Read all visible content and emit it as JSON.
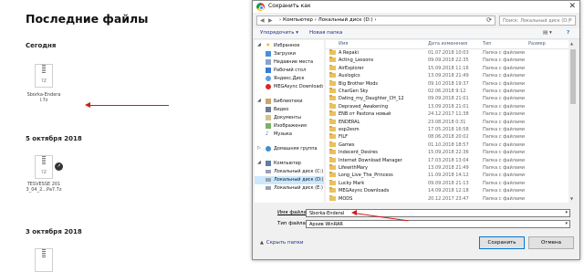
{
  "background": {
    "title": "Последние файлы",
    "sections": [
      {
        "label": "Сегодня",
        "file": {
          "ext": "7Z",
          "name_line1": "Sborka-Endera",
          "name_line2": "l.7z"
        }
      },
      {
        "label": "5 октября 2018",
        "file": {
          "ext": "7Z",
          "name_line1": "TESVESSE 201",
          "name_line2": "3_04_2...Pa7.7z"
        }
      },
      {
        "label": "3 октября 2018"
      }
    ]
  },
  "dialog": {
    "title": "Сохранить как",
    "close_icon": "close-icon",
    "address": {
      "crumbs": "›  Компьютер  ›  Локальный диск (D:)  ›"
    },
    "search_placeholder": "Поиск: Локальный диск (D:)",
    "toolbar": {
      "organize": "Упорядочить ▾",
      "new_folder": "Новая папка"
    },
    "nav": [
      {
        "label": "Избранное",
        "icon": "star-icon",
        "expander": "◢"
      },
      {
        "label": "Загрузки",
        "icon": "downloads-icon"
      },
      {
        "label": "Недавние места",
        "icon": "recent-places-icon"
      },
      {
        "label": "Рабочий стол",
        "icon": "desktop-icon"
      },
      {
        "label": "Яндекс.Диск",
        "icon": "yandex-disk-icon"
      },
      {
        "label": "MEGAsync Downloads",
        "icon": "mega-icon"
      },
      {
        "label": "Библиотеки",
        "icon": "libraries-icon",
        "expander": "◢"
      },
      {
        "label": "Видео",
        "icon": "video-icon"
      },
      {
        "label": "Документы",
        "icon": "documents-icon"
      },
      {
        "label": "Изображения",
        "icon": "images-icon"
      },
      {
        "label": "Музыка",
        "icon": "music-icon"
      },
      {
        "label": "Домашняя группа",
        "icon": "homegroup-icon",
        "expander": "▷"
      },
      {
        "label": "Компьютер",
        "icon": "computer-icon",
        "expander": "◢"
      },
      {
        "label": "Локальный диск (C:)",
        "icon": "drive-icon"
      },
      {
        "label": "Локальный диск (D:)",
        "icon": "drive-icon",
        "selected": true
      },
      {
        "label": "Локальный диск (E:)",
        "icon": "drive-icon"
      }
    ],
    "columns": {
      "name": "Имя",
      "date": "Дата изменения",
      "type": "Тип",
      "size": "Размер"
    },
    "rows": [
      {
        "name": "A Repaki",
        "date": "01.07.2018 10:03",
        "type": "Папка с файлами"
      },
      {
        "name": "Acting_Lessons",
        "date": "09.09.2018 22:35",
        "type": "Папка с файлами"
      },
      {
        "name": "AirExplorer",
        "date": "15.09.2018 11:16",
        "type": "Папка с файлами"
      },
      {
        "name": "Auslogics",
        "date": "13.09.2018 21:49",
        "type": "Папка с файлами"
      },
      {
        "name": "Big Brother Mods",
        "date": "09.10.2018 19:37",
        "type": "Папка с файлами"
      },
      {
        "name": "CharGen Sky",
        "date": "02.06.2018 9:12",
        "type": "Папка с файлами"
      },
      {
        "name": "Dating_my_Daughter_CH_12",
        "date": "09.09.2018 21:01",
        "type": "Папка с файлами"
      },
      {
        "name": "Depraved_Awakening",
        "date": "13.09.2018 21:01",
        "type": "Папка с файлами"
      },
      {
        "name": "ENB от Pastona новый",
        "date": "24.12.2017 11:38",
        "type": "Папка с файлами"
      },
      {
        "name": "ENDERAL",
        "date": "23.08.2018 0:31",
        "type": "Папка с файлами"
      },
      {
        "name": "esp2esm",
        "date": "17.05.2018 16:58",
        "type": "Папка с файлами"
      },
      {
        "name": "FILF",
        "date": "08.06.2018 20:02",
        "type": "Папка с файлами"
      },
      {
        "name": "Games",
        "date": "01.10.2018 18:57",
        "type": "Папка с файлами"
      },
      {
        "name": "Indecent_Desires",
        "date": "15.09.2018 22:36",
        "type": "Папка с файлами"
      },
      {
        "name": "Internet Download Manager",
        "date": "17.03.2018 13:04",
        "type": "Папка с файлами"
      },
      {
        "name": "LifewithMary",
        "date": "13.09.2018 21:49",
        "type": "Папка с файлами"
      },
      {
        "name": "Long_Live_The_Princess",
        "date": "11.09.2018 14:12",
        "type": "Папка с файлами"
      },
      {
        "name": "Lucky Mark",
        "date": "09.09.2018 21:13",
        "type": "Папка с файлами"
      },
      {
        "name": "MEGAsync Downloads",
        "date": "14.09.2018 12:18",
        "type": "Папка с файлами"
      },
      {
        "name": "MODS",
        "date": "20.12.2017 23:47",
        "type": "Папка с файлами"
      }
    ],
    "filename_label": "Имя файла:",
    "filename_value": "Sborka-Enderal",
    "filetype_label": "Тип файла:",
    "filetype_value": "Архив WinRAR",
    "hide_folders": "Скрыть папки",
    "save_button": "Сохранить",
    "cancel_button": "Отмена"
  },
  "annotation_color": "#d21a1a"
}
